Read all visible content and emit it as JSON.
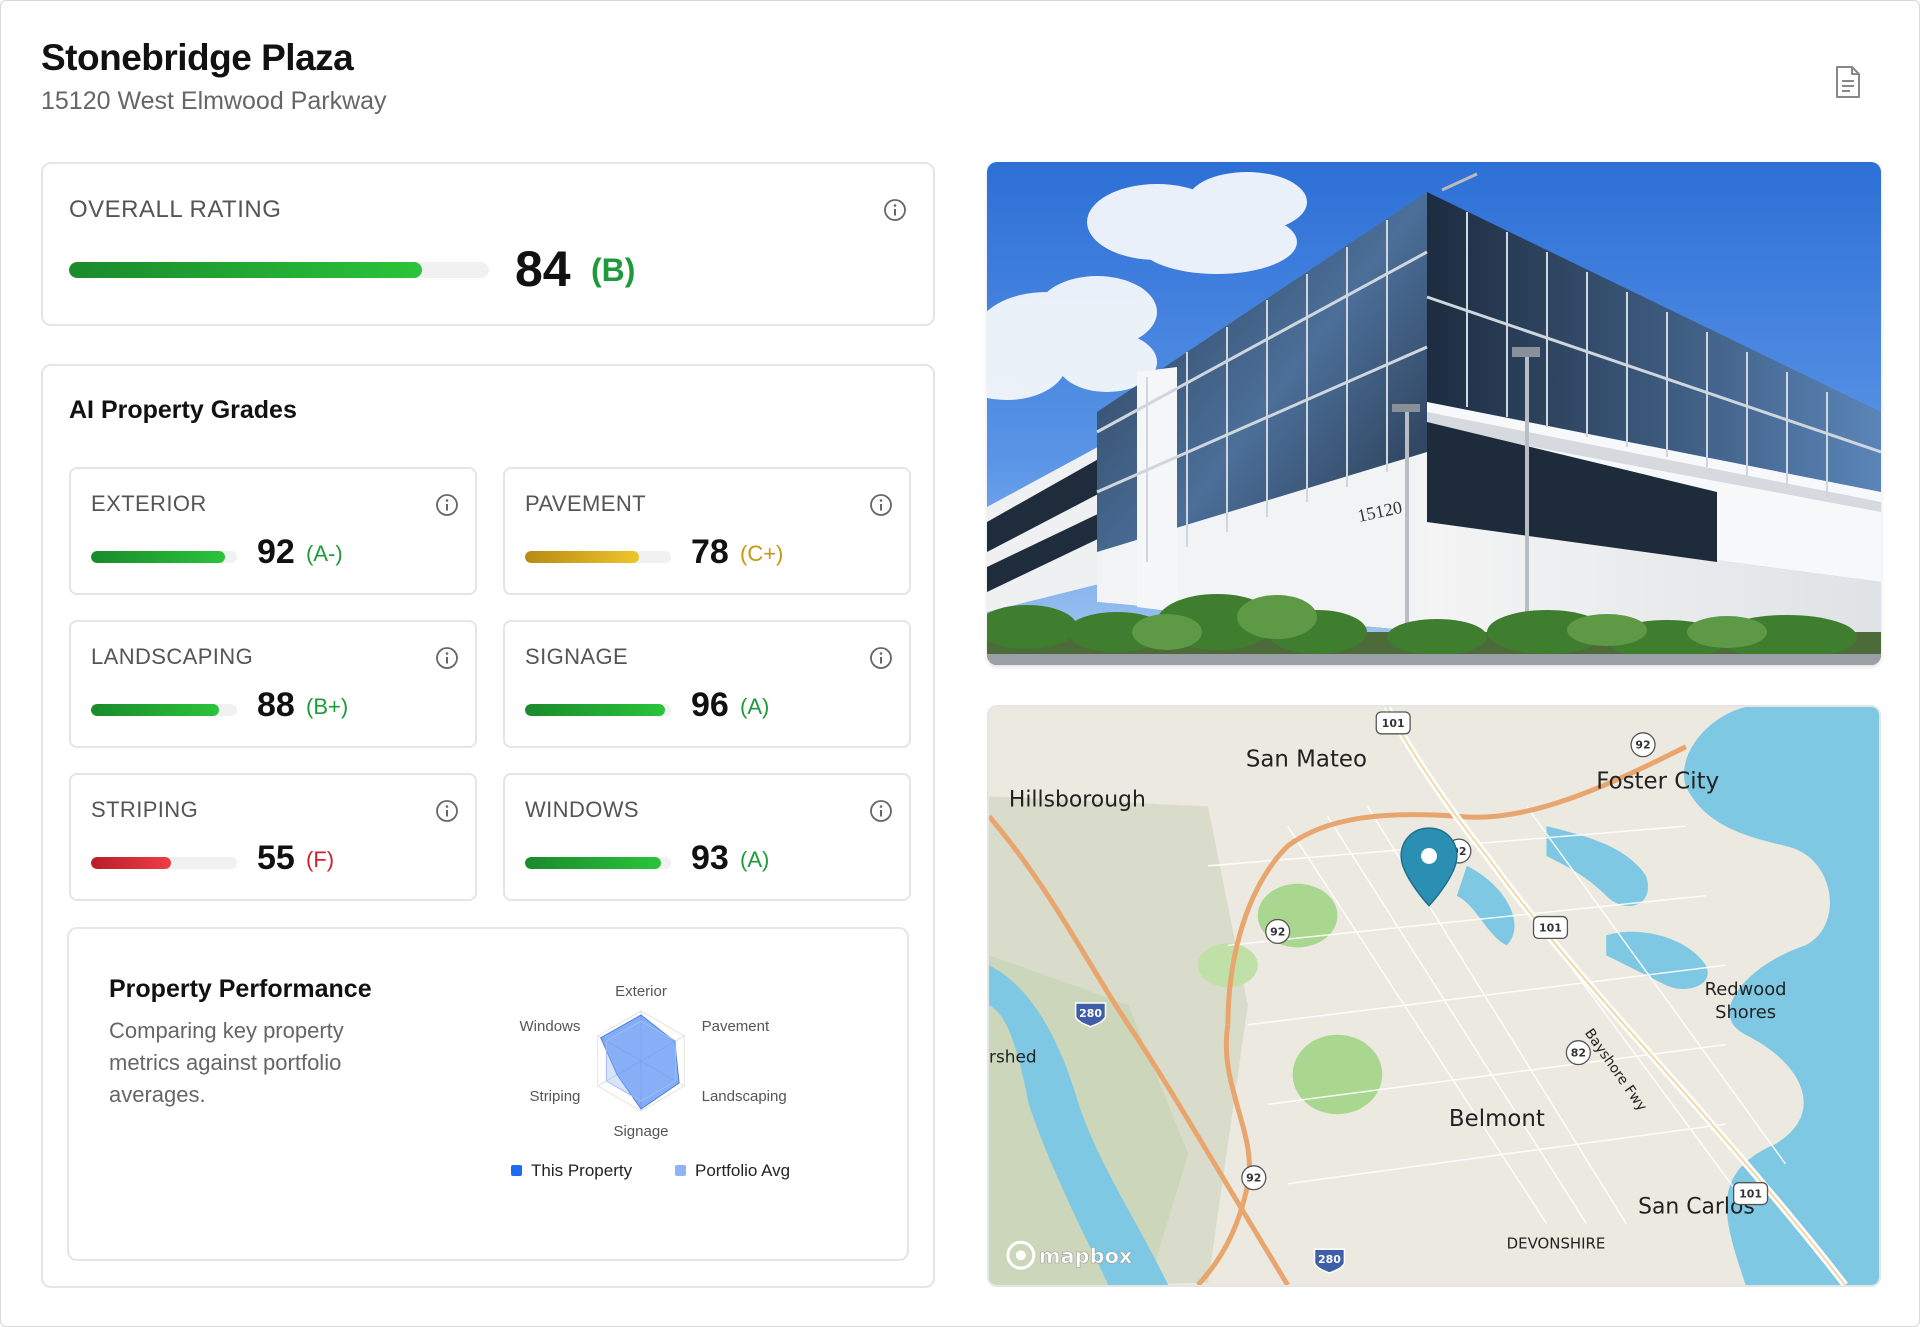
{
  "header": {
    "title": "Stonebridge Plaza",
    "subtitle": "15120 West Elmwood Parkway",
    "doc_icon": "document-icon"
  },
  "overall": {
    "label": "OVERALL RATING",
    "score": "84",
    "grade": "(B)",
    "progress": 0.84,
    "color": "#22b534"
  },
  "grades_section": {
    "title": "AI Property Grades",
    "items": [
      {
        "label": "EXTERIOR",
        "score": "92",
        "grade": "(A-)",
        "progress": 0.92,
        "status": "green"
      },
      {
        "label": "PAVEMENT",
        "score": "78",
        "grade": "(C+)",
        "progress": 0.78,
        "status": "yellow"
      },
      {
        "label": "LANDSCAPING",
        "score": "88",
        "grade": "(B+)",
        "progress": 0.88,
        "status": "green"
      },
      {
        "label": "SIGNAGE",
        "score": "96",
        "grade": "(A)",
        "progress": 0.96,
        "status": "green"
      },
      {
        "label": "STRIPING",
        "score": "55",
        "grade": "(F)",
        "progress": 0.55,
        "status": "red"
      },
      {
        "label": "WINDOWS",
        "score": "93",
        "grade": "(A)",
        "progress": 0.93,
        "status": "green"
      }
    ]
  },
  "performance": {
    "title": "Property Performance",
    "description": "Comparing key property metrics against portfolio averages.",
    "chart_data": {
      "type": "radar",
      "axes": [
        "Exterior",
        "Pavement",
        "Landscaping",
        "Signage",
        "Striping",
        "Windows"
      ],
      "series": [
        {
          "name": "This Property",
          "values": [
            92,
            78,
            88,
            96,
            55,
            93
          ],
          "color": "#1a6cf0"
        },
        {
          "name": "Portfolio Avg",
          "values": [
            80,
            80,
            80,
            80,
            80,
            80
          ],
          "color": "#8fb3f5"
        }
      ],
      "range": [
        0,
        100
      ]
    },
    "legend": {
      "this_property": "This Property",
      "portfolio_avg": "Portfolio Avg"
    }
  },
  "photo": {
    "building_number": "15120"
  },
  "map": {
    "places": [
      "San Mateo",
      "Foster City",
      "Hillsborough",
      "Belmont",
      "San Carlos",
      "Redwood",
      "Shores",
      "DEVONSHIRE",
      "Bayshore Fwy",
      "rshed"
    ],
    "shields": [
      "101",
      "92",
      "92",
      "92",
      "101",
      "82",
      "101",
      "280",
      "280",
      "92"
    ],
    "attribution": "mapbox",
    "marker_color": "#2a8fb3"
  }
}
